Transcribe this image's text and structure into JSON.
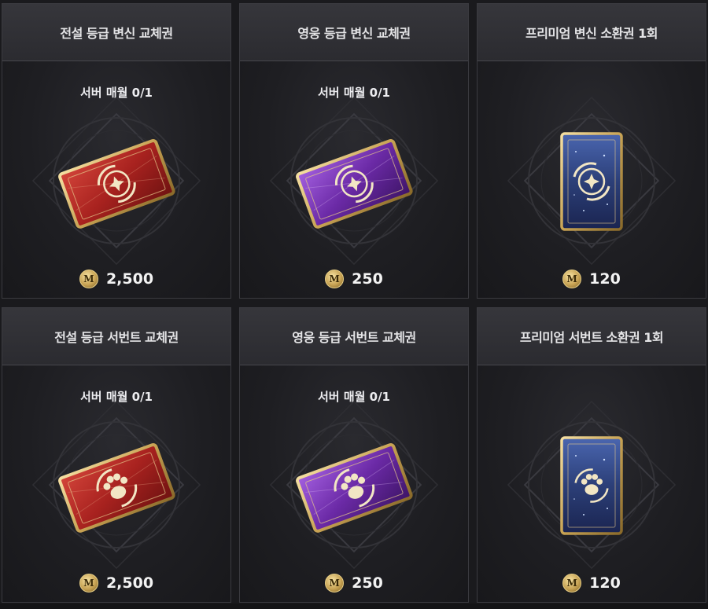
{
  "cards": [
    {
      "title": "전설 등급 변신 교체권",
      "limit": "서버 매월 0/1",
      "price": "2,500",
      "item": "red-transform-ticket",
      "icon": "coin-icon"
    },
    {
      "title": "영웅 등급 변신 교체권",
      "limit": "서버 매월 0/1",
      "price": "250",
      "item": "purple-transform-ticket",
      "icon": "coin-icon"
    },
    {
      "title": "프리미엄 변신 소환권 1회",
      "limit": "",
      "price": "120",
      "item": "blue-transform-summon-card",
      "icon": "coin-icon"
    },
    {
      "title": "전설 등급 서번트 교체권",
      "limit": "서버 매월 0/1",
      "price": "2,500",
      "item": "red-servant-ticket",
      "icon": "coin-icon"
    },
    {
      "title": "영웅 등급 서번트 교체권",
      "limit": "서버 매월 0/1",
      "price": "250",
      "item": "purple-servant-ticket",
      "icon": "coin-icon"
    },
    {
      "title": "프리미엄 서번트 소환권 1회",
      "limit": "",
      "price": "120",
      "item": "blue-servant-summon-card",
      "icon": "coin-icon"
    }
  ],
  "colors": {
    "legendary": "#a8221f",
    "heroic": "#6b2aa6",
    "premium": "#2c3f78",
    "gold": "#c8a354"
  }
}
